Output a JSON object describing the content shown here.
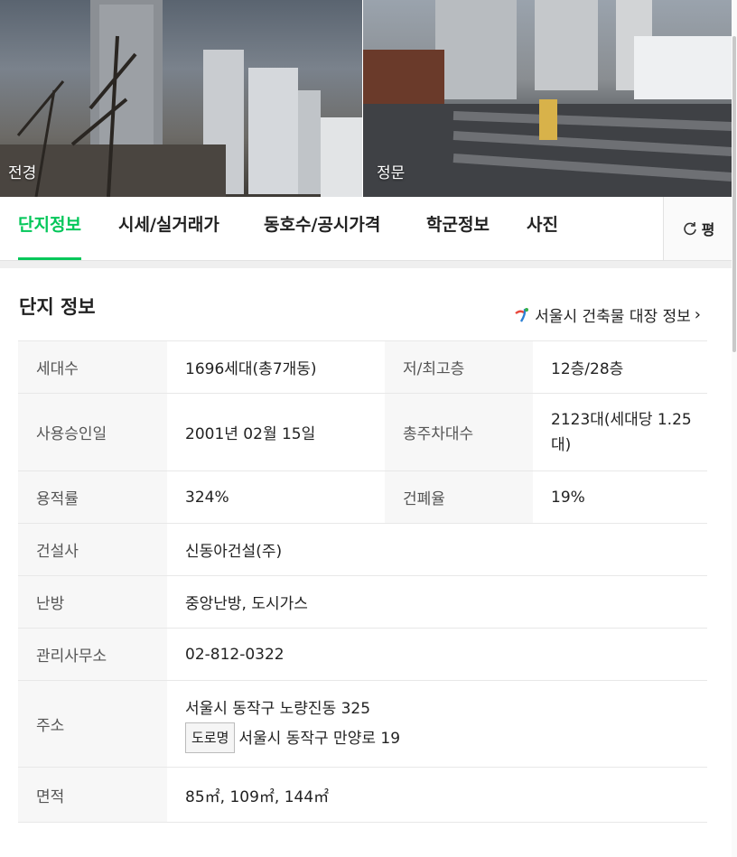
{
  "photos": [
    {
      "caption": "전경"
    },
    {
      "caption": "정문"
    }
  ],
  "tabs": [
    {
      "label": "단지정보",
      "active": true
    },
    {
      "label": "시세/실거래가",
      "active": false
    },
    {
      "label": "동호수/공시가격",
      "active": false
    },
    {
      "label": "학군정보",
      "active": false
    },
    {
      "label": "사진",
      "active": false
    }
  ],
  "unit_toggle": {
    "label": "평",
    "icon": "refresh-icon"
  },
  "section": {
    "title": "단지 정보",
    "external_link": "서울시 건축물 대장 정보",
    "link_icon": "seoul-logo-icon"
  },
  "info": {
    "households_label": "세대수",
    "households_value": "1696세대(총7개동)",
    "floors_label": "저/최고층",
    "floors_value": "12층/28층",
    "approval_label": "사용승인일",
    "approval_value": "2001년 02월 15일",
    "parking_label": "총주차대수",
    "parking_value": "2123대(세대당 1.25대)",
    "far_label": "용적률",
    "far_value": "324%",
    "bcr_label": "건폐율",
    "bcr_value": "19%",
    "builder_label": "건설사",
    "builder_value": "신동아건설(주)",
    "heating_label": "난방",
    "heating_value": "중앙난방, 도시가스",
    "office_label": "관리사무소",
    "office_value": "02-812-0322",
    "address_label": "주소",
    "address_lot": "서울시 동작구 노량진동 325",
    "road_badge": "도로명",
    "address_road": "서울시 동작구 만양로 19",
    "area_label": "면적",
    "area_value": "85㎡, 109㎡, 144㎡"
  },
  "colors": {
    "accent": "#03c75a"
  }
}
